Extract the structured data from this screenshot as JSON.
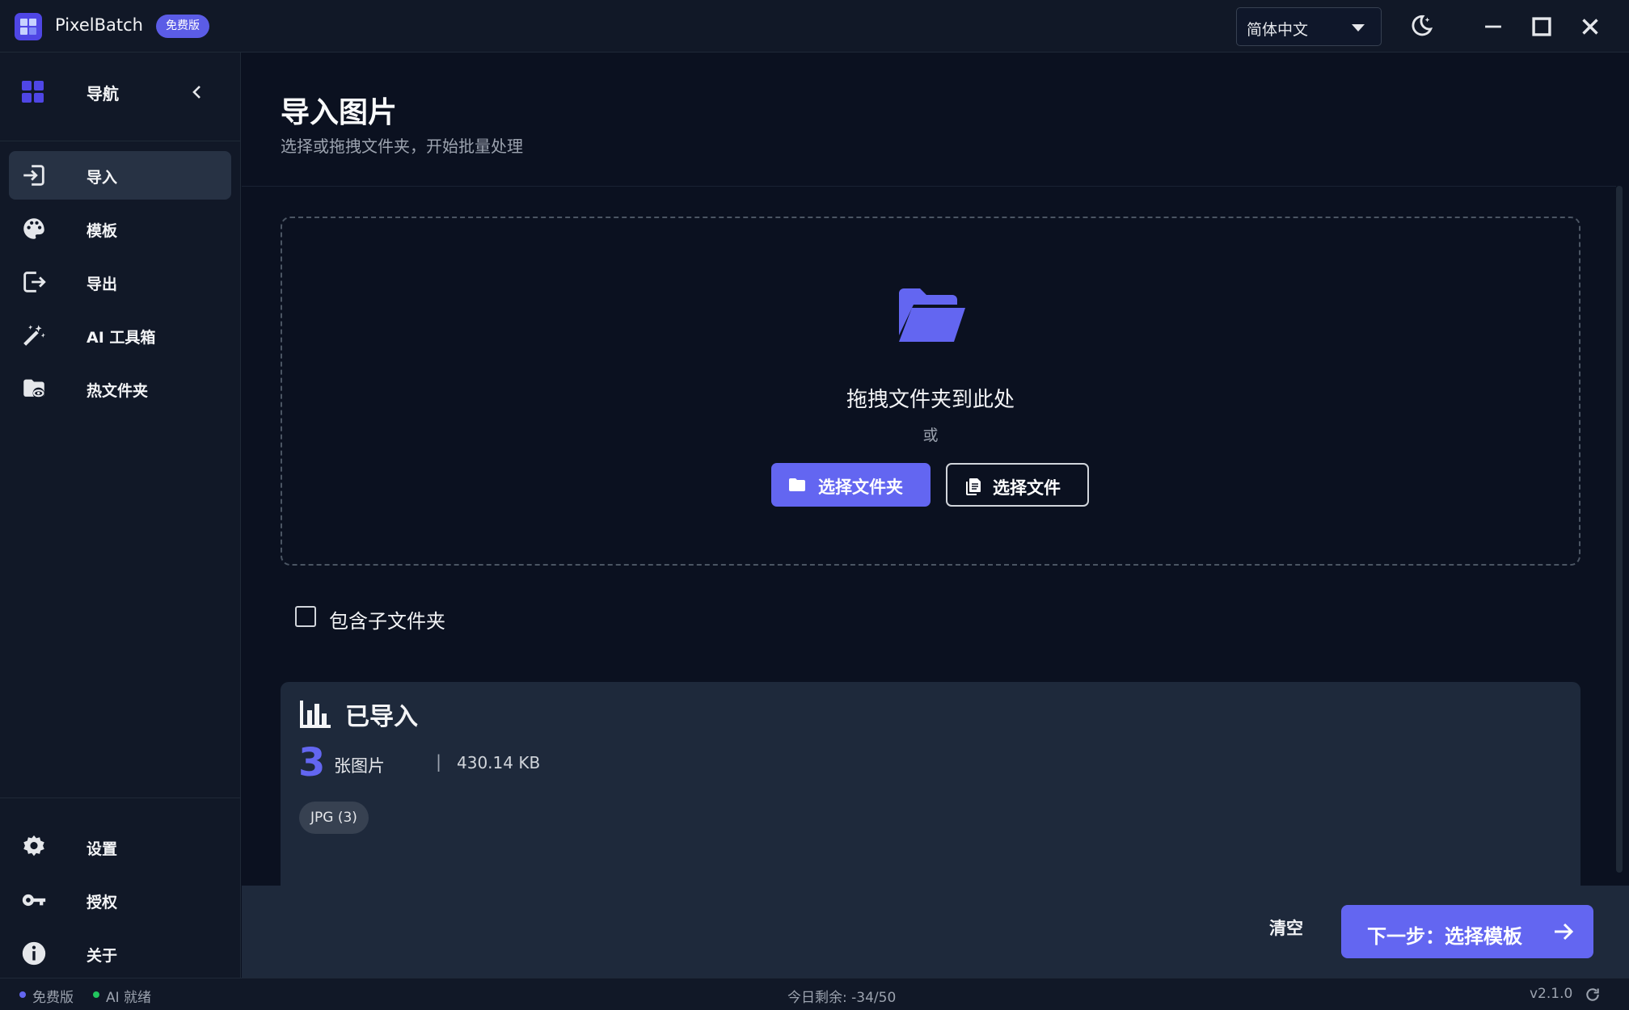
{
  "app": {
    "name": "PixelBatch",
    "plan_badge": "免费版",
    "language": "简体中文"
  },
  "sidebar": {
    "header_label": "导航",
    "items": [
      {
        "label": "导入",
        "icon": "import-icon",
        "active": true
      },
      {
        "label": "模板",
        "icon": "palette-icon",
        "active": false
      },
      {
        "label": "导出",
        "icon": "export-icon",
        "active": false
      },
      {
        "label": "AI 工具箱",
        "icon": "magic-wand-icon",
        "active": false
      },
      {
        "label": "热文件夹",
        "icon": "watch-folder-icon",
        "active": false
      }
    ],
    "bottom_items": [
      {
        "label": "设置",
        "icon": "gear-icon"
      },
      {
        "label": "授权",
        "icon": "key-icon"
      },
      {
        "label": "关于",
        "icon": "info-icon"
      }
    ]
  },
  "page": {
    "title": "导入图片",
    "subtitle": "选择或拖拽文件夹，开始批量处理"
  },
  "dropzone": {
    "drop_text": "拖拽文件夹到此处",
    "or_text": "或",
    "select_folder_label": "选择文件夹",
    "select_file_label": "选择文件"
  },
  "options": {
    "include_subfolders_label": "包含子文件夹",
    "include_subfolders_checked": false
  },
  "imported": {
    "title": "已导入",
    "count": "3",
    "count_unit": "张图片",
    "separator": "|",
    "total_size": "430.14 KB",
    "types": [
      "JPG (3)"
    ]
  },
  "footer": {
    "clear_label": "清空",
    "next_label": "下一步：选择模板"
  },
  "status": {
    "plan": "免费版",
    "ai_status": "AI 就绪",
    "quota": "今日剩余: -34/50",
    "version": "v2.1.0"
  },
  "colors": {
    "accent": "#6366f1",
    "background": "#0b1120",
    "panel": "#1e293b",
    "sidebar": "#111827",
    "ai_ready": "#22c55e"
  }
}
